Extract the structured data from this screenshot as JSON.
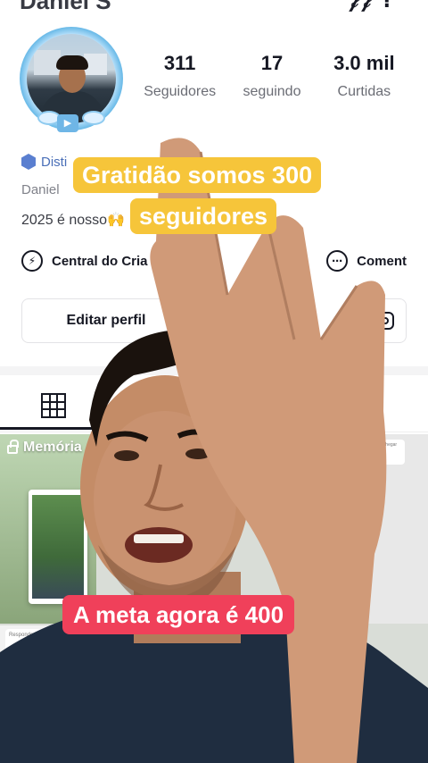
{
  "header": {
    "name_partial": "Daniel S",
    "icons_partial": "𝒻𝒻 ⁝"
  },
  "stats": [
    {
      "value": "311",
      "label": "Seguidores"
    },
    {
      "value": "17",
      "label": "seguindo"
    },
    {
      "value": "3.0 mil",
      "label": "Curtidas"
    }
  ],
  "profile": {
    "badge_text": "Disti",
    "username_partial": "Daniel",
    "bio": "2025 é nosso🙌",
    "creator_link": "Central do Cria",
    "comments_link": "Coment",
    "edit_button": "Editar perfil"
  },
  "tabs": {
    "grid_icon": "grid-icon",
    "saved_icon": "bookmark-icon"
  },
  "grid": {
    "memory_label": "Memória",
    "mini_card_text": "Responder a @Dani...",
    "right_card_text": "...pra chegar"
  },
  "captions": {
    "line1": "Gratidão somos 300",
    "line2": "seguidores",
    "goal": "A meta agora é 400"
  },
  "colors": {
    "caption_yellow": "#f6c53a",
    "caption_red": "#f0405a",
    "avatar_ring": "#6cbbe8"
  }
}
